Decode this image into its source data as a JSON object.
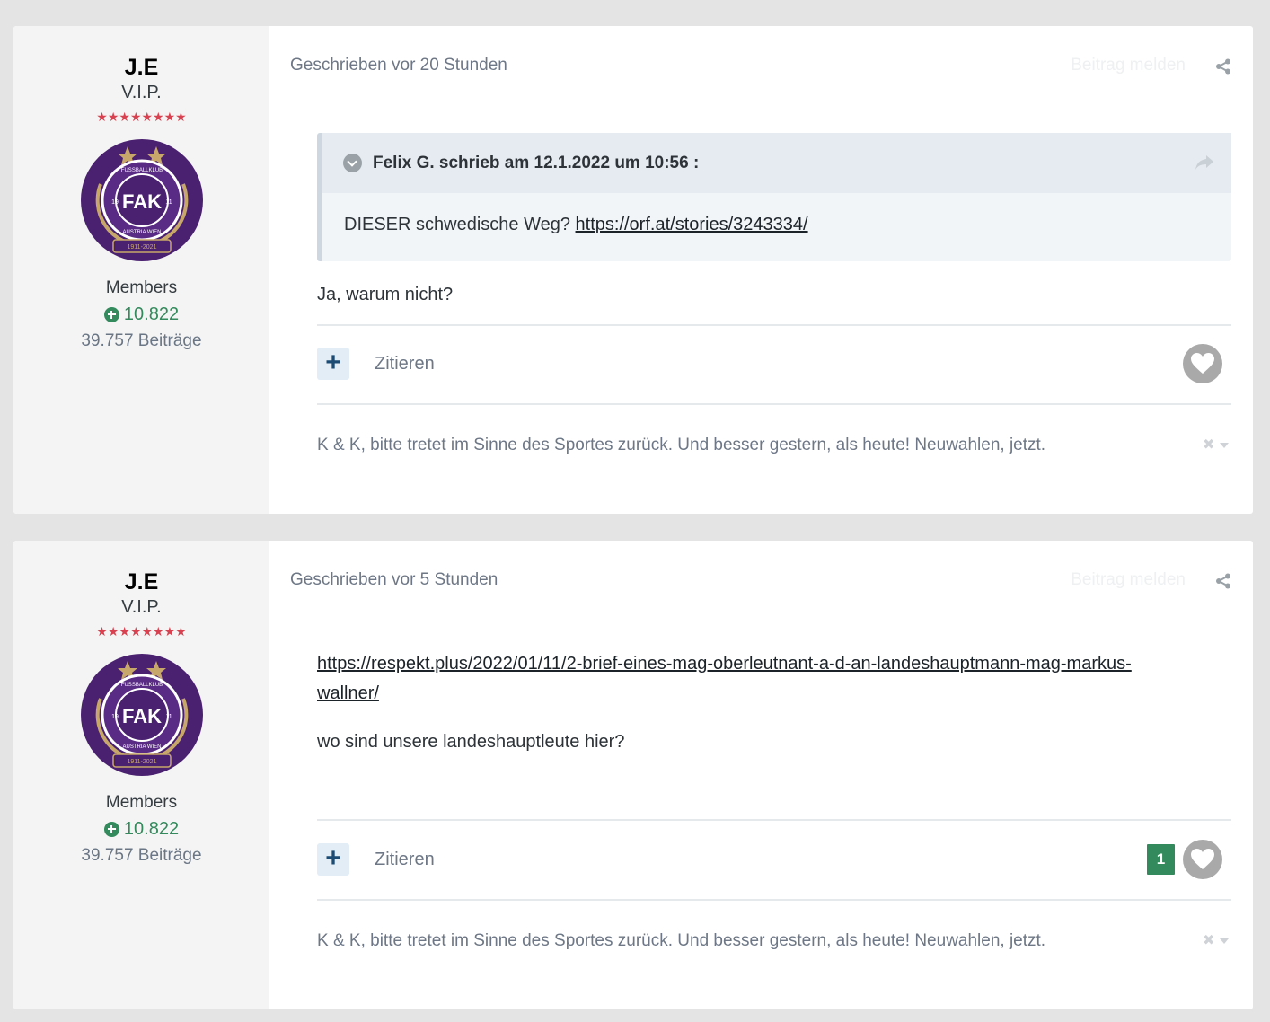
{
  "posts": [
    {
      "author": {
        "name": "J.E",
        "title": "V.I.P.",
        "stars": "★★★★★★★★",
        "group": "Members",
        "reputation": "10.822",
        "post_count": "39.757 Beiträge"
      },
      "meta": "Geschrieben vor 20 Stunden",
      "report": "Beitrag melden",
      "quote": {
        "citation": "Felix G. schrieb am 12.1.2022 um 10:56 :",
        "text": "DIESER schwedische Weg? ",
        "link": "https://orf.at/stories/3243334/"
      },
      "body": [
        "Ja, warum nicht?"
      ],
      "actions": {
        "quote_label": "Zitieren",
        "plus": "+"
      },
      "signature": "K & K, bitte tretet im Sinne des Sportes zurück. Und besser gestern, als heute! Neuwahlen, jetzt."
    },
    {
      "author": {
        "name": "J.E",
        "title": "V.I.P.",
        "stars": "★★★★★★★★",
        "group": "Members",
        "reputation": "10.822",
        "post_count": "39.757 Beiträge"
      },
      "meta": "Geschrieben vor 5 Stunden",
      "report": "Beitrag melden",
      "link_line1": "https://respekt.plus/2022/01/11/2-brief-eines-mag-oberleutnant-a-d-an-landeshauptmann-mag-markus-",
      "link_line2": "wallner/",
      "body": [
        "wo sind unsere landeshauptleute hier?"
      ],
      "actions": {
        "quote_label": "Zitieren",
        "plus": "+",
        "like_count": "1"
      },
      "signature": "K & K, bitte tretet im Sinne des Sportes zurück. Und besser gestern, als heute! Neuwahlen, jetzt."
    }
  ],
  "avatar": {
    "top_text": "FUSSBALLKLUB",
    "bottom_text": "AUSTRIA WIEN",
    "center": "FAK",
    "year_left": "19",
    "year_right": "11",
    "years": "1911-2021"
  },
  "colors": {
    "page_bg": "#e4e4e4",
    "author_bg": "#f4f4f4",
    "reputation": "#338a5c",
    "stars": "#d8414f",
    "avatar_purple": "#4a2170",
    "avatar_gold": "#c8a86a"
  }
}
